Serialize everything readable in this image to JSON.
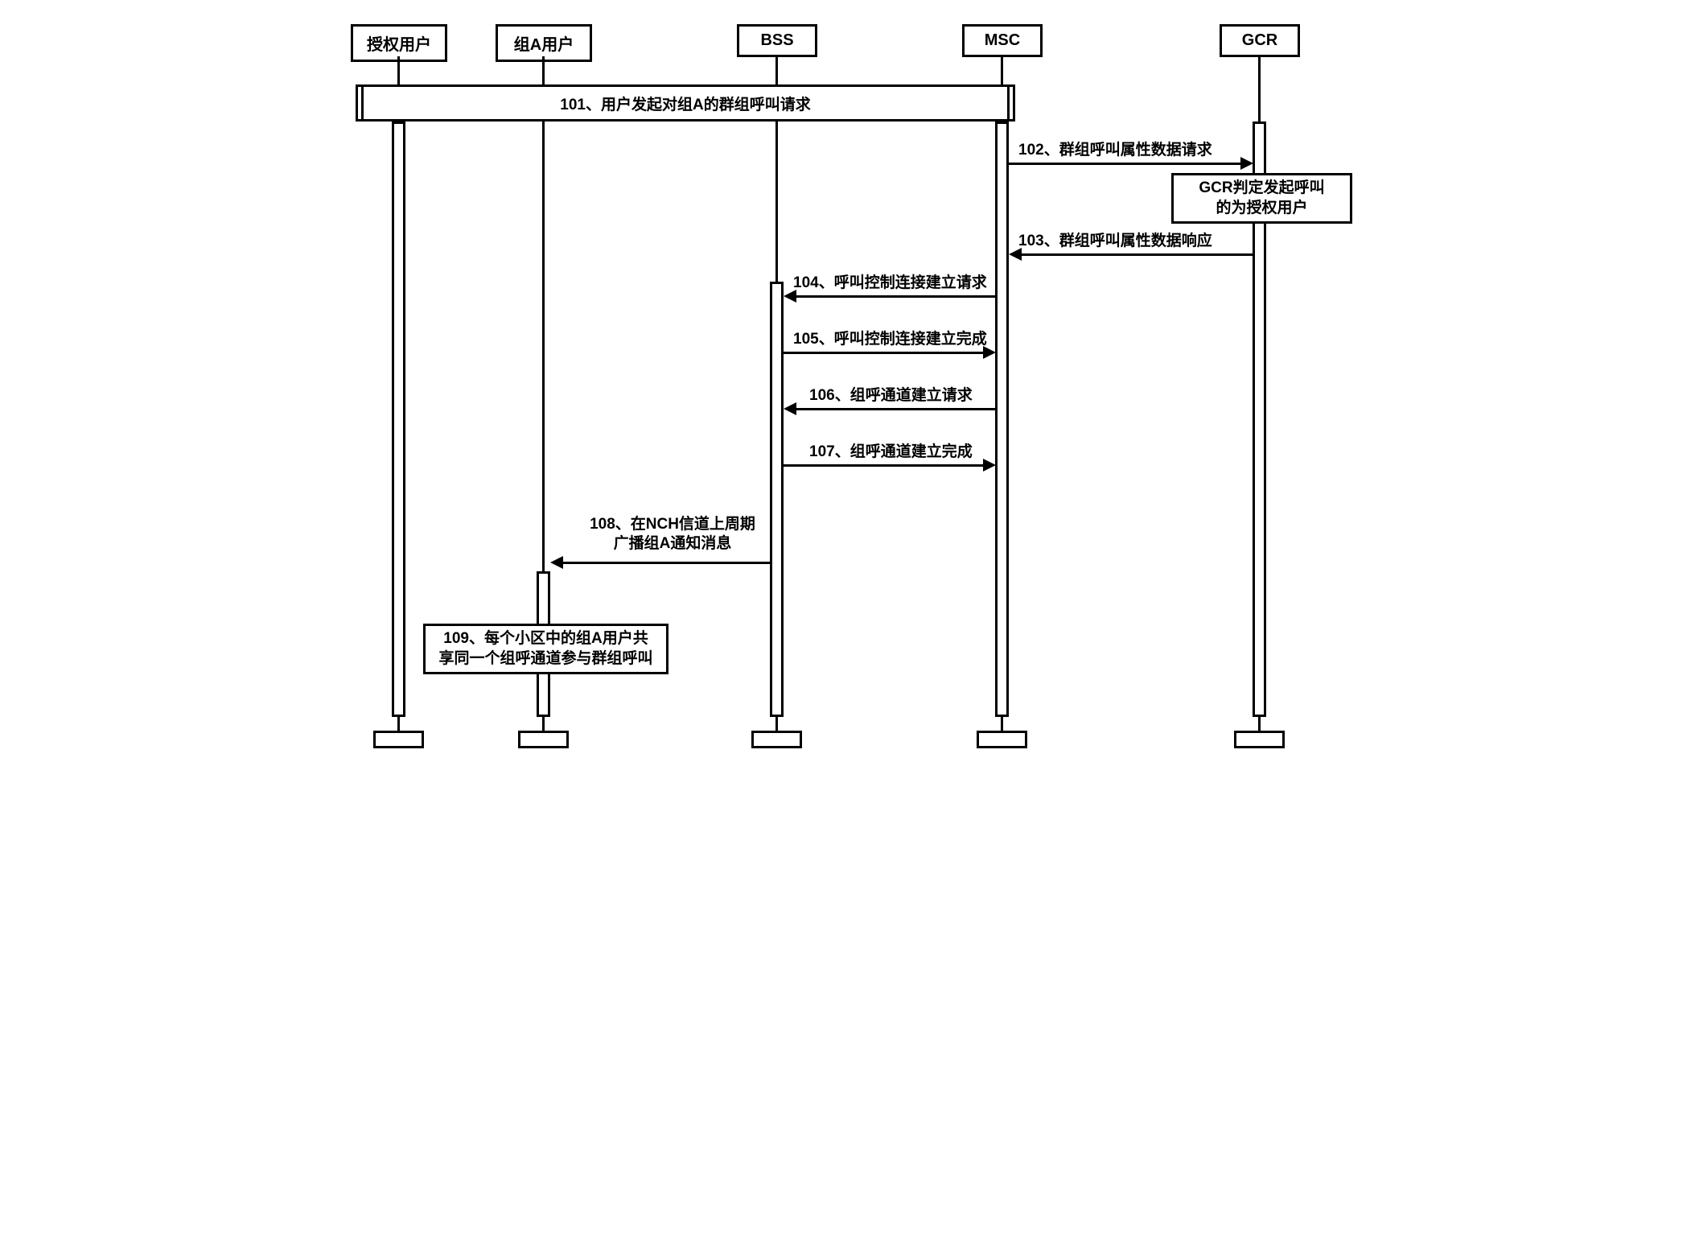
{
  "actors": {
    "authUser": "授权用户",
    "groupAUser": "组A用户",
    "bss": "BSS",
    "msc": "MSC",
    "gcr": "GCR"
  },
  "messages": {
    "m101": "101、用户发起对组A的群组呼叫请求",
    "m102": "102、群组呼叫属性数据请求",
    "m103": "103、群组呼叫属性数据响应",
    "m104": "104、呼叫控制连接建立请求",
    "m105": "105、呼叫控制连接建立完成",
    "m106": "106、组呼通道建立请求",
    "m107": "107、组呼通道建立完成",
    "m108_l1": "108、在NCH信道上周期",
    "m108_l2": "广播组A通知消息"
  },
  "notes": {
    "gcrNote_l1": "GCR判定发起呼叫",
    "gcrNote_l2": "的为授权用户",
    "n109_l1": "109、每个小区中的组A用户共",
    "n109_l2": "享同一个组呼通道参与群组呼叫"
  }
}
